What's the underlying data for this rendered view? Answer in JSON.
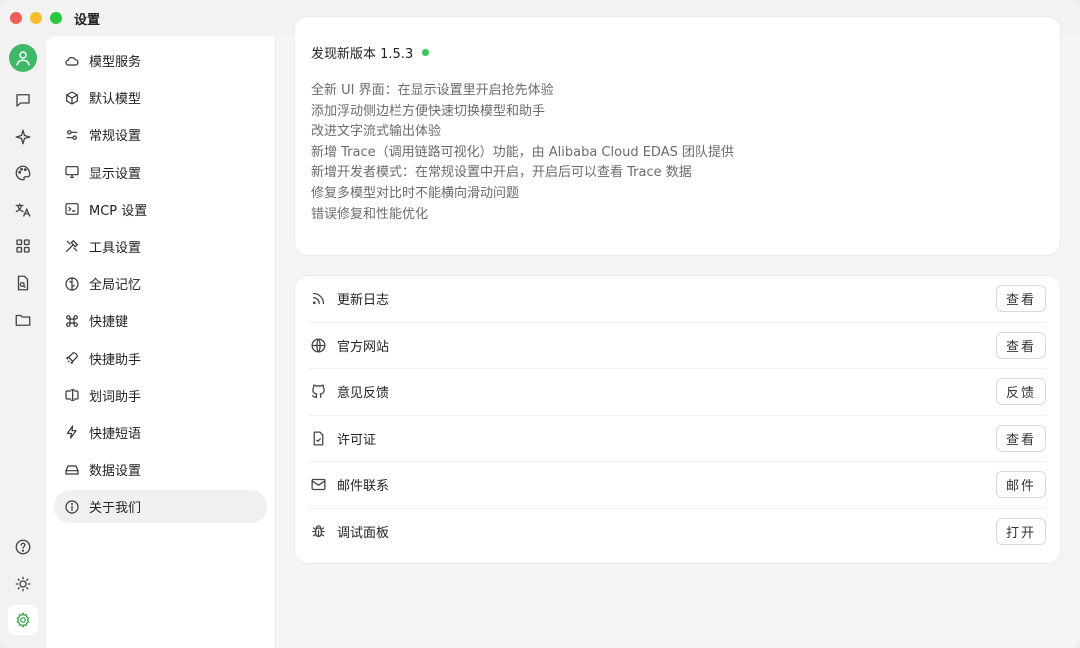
{
  "window": {
    "title": "设置"
  },
  "rail": {
    "icons": [
      "user-icon",
      "chat-icon",
      "sparkle-icon",
      "palette-icon",
      "translate-icon",
      "apps-icon",
      "file-search-icon",
      "folder-icon",
      "help-icon",
      "theme-icon",
      "settings-icon"
    ]
  },
  "menu": {
    "items": [
      {
        "label": "模型服务",
        "icon": "cloud-icon"
      },
      {
        "label": "默认模型",
        "icon": "cube-icon"
      },
      {
        "label": "常规设置",
        "icon": "sliders-icon"
      },
      {
        "label": "显示设置",
        "icon": "monitor-icon"
      },
      {
        "label": "MCP 设置",
        "icon": "terminal-icon"
      },
      {
        "label": "工具设置",
        "icon": "tools-icon"
      },
      {
        "label": "全局记忆",
        "icon": "brain-icon"
      },
      {
        "label": "快捷键",
        "icon": "command-icon"
      },
      {
        "label": "快捷助手",
        "icon": "rocket-icon"
      },
      {
        "label": "划词助手",
        "icon": "text-cursor-icon"
      },
      {
        "label": "快捷短语",
        "icon": "zap-icon"
      },
      {
        "label": "数据设置",
        "icon": "drive-icon"
      },
      {
        "label": "关于我们",
        "icon": "info-icon"
      }
    ],
    "active": "关于我们"
  },
  "about": {
    "version_label": "发现新版本 1.5.3",
    "status_color": "#34c759",
    "notes": [
      "全新 UI 界面：在显示设置里开启抢先体验",
      "添加浮动侧边栏方便快速切换模型和助手",
      "改进文字流式输出体验",
      "新增 Trace（调用链路可视化）功能，由 Alibaba Cloud EDAS 团队提供",
      "新增开发者模式：在常规设置中开启，开启后可以查看 Trace 数据",
      "修复多模型对比时不能横向滑动问题",
      "错误修复和性能优化"
    ]
  },
  "links": [
    {
      "label": "更新日志",
      "button": "查看",
      "icon": "rss-icon"
    },
    {
      "label": "官方网站",
      "button": "查看",
      "icon": "globe-icon"
    },
    {
      "label": "意见反馈",
      "button": "反馈",
      "icon": "github-icon"
    },
    {
      "label": "许可证",
      "button": "查看",
      "icon": "file-check-icon"
    },
    {
      "label": "邮件联系",
      "button": "邮件",
      "icon": "mail-icon"
    },
    {
      "label": "调试面板",
      "button": "打开",
      "icon": "bug-icon"
    }
  ],
  "colors": {
    "accent": "#3fb86a"
  }
}
